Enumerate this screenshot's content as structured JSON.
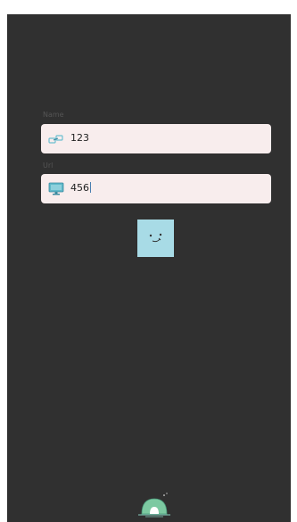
{
  "status_bar": {
    "text": ""
  },
  "form": {
    "name_label": "Name",
    "name_value": "123",
    "url_label": "Url",
    "url_value": "456"
  },
  "icons": {
    "name_field": "link-chain-icon",
    "url_field": "monitor-icon",
    "face_button": "smiley-face-icon",
    "bottom": "igloo-logo-icon"
  },
  "colors": {
    "app_background": "#303030",
    "input_background": "#f8eded",
    "face_button": "#a8dbe6",
    "logo_green": "#7cc9a1"
  }
}
